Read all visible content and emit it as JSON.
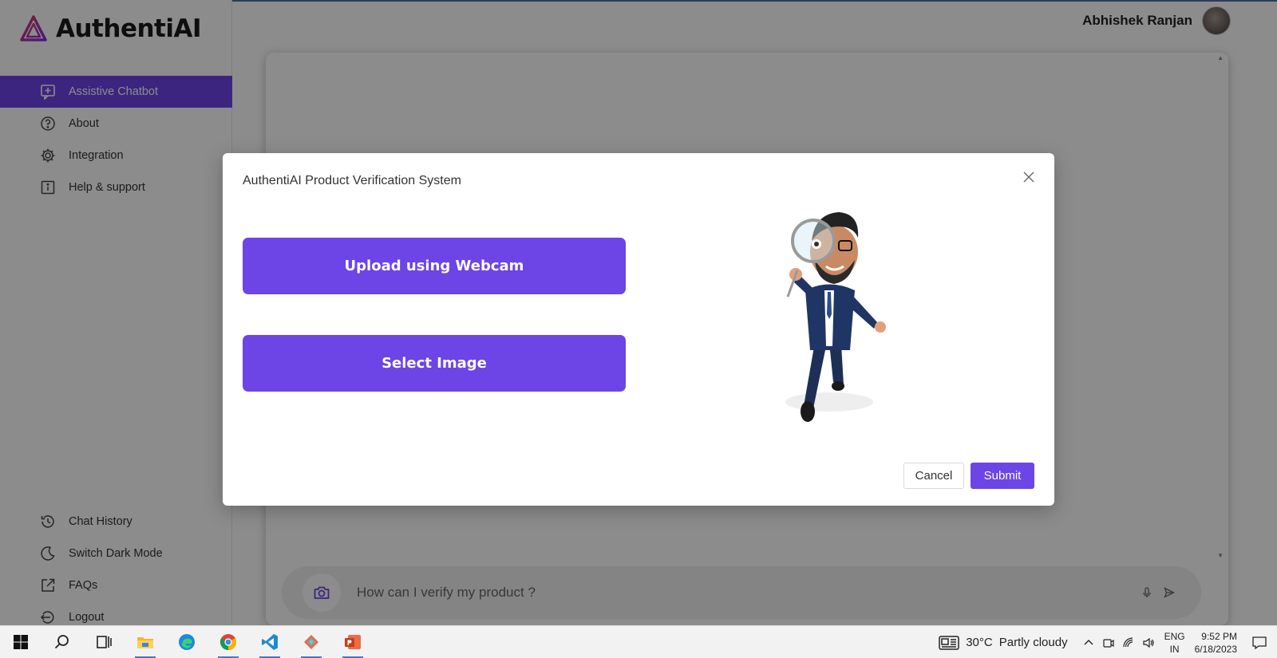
{
  "app": {
    "brand_name": "AuthentiAI",
    "accent_color": "#6d44e6"
  },
  "sidebar": {
    "top_items": [
      {
        "label": "Assistive Chatbot",
        "icon": "chat-plus-icon",
        "active": true
      },
      {
        "label": "About",
        "icon": "question-circle-icon"
      },
      {
        "label": "Integration",
        "icon": "gear-icon"
      },
      {
        "label": "Help & support",
        "icon": "info-square-icon"
      }
    ],
    "bottom_items": [
      {
        "label": "Chat History",
        "icon": "history-icon"
      },
      {
        "label": "Switch Dark Mode",
        "icon": "moon-icon"
      },
      {
        "label": "FAQs",
        "icon": "external-link-icon"
      },
      {
        "label": "Logout",
        "icon": "logout-icon"
      }
    ]
  },
  "header": {
    "user_name": "Abhishek Ranjan"
  },
  "chat": {
    "input_placeholder": "How can I verify my product ?"
  },
  "modal": {
    "title": "AuthentiAI Product Verification System",
    "webcam_button": "Upload using Webcam",
    "select_button": "Select Image",
    "cancel_button": "Cancel",
    "submit_button": "Submit",
    "illustration": "detective-mascot-with-magnifying-glass"
  },
  "taskbar": {
    "apps": [
      "start-icon",
      "search-icon",
      "task-view-icon",
      "file-explorer-icon",
      "edge-icon",
      "chrome-icon",
      "vscode-icon",
      "git-icon",
      "powerpoint-icon"
    ],
    "weather_temp": "30°C",
    "weather_condition": "Partly cloudy",
    "lang_top": "ENG",
    "lang_bottom": "IN",
    "time": "9:52 PM",
    "date": "6/18/2023"
  }
}
